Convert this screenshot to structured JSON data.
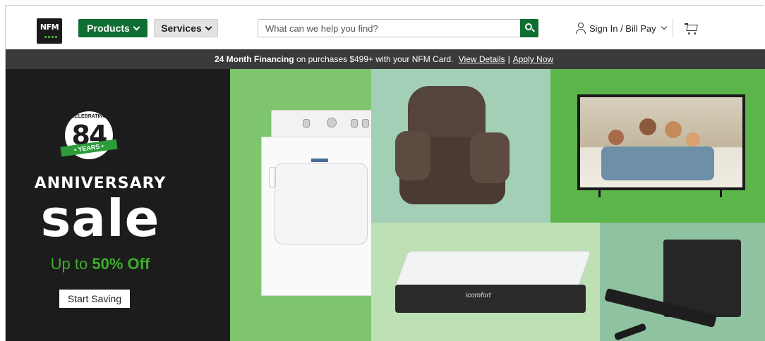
{
  "header": {
    "logo_text": "NFM",
    "products_label": "Products",
    "services_label": "Services",
    "search_placeholder": "What can we help you find?",
    "signin_label": "Sign In / Bill Pay"
  },
  "promo": {
    "bold": "24 Month Financing",
    "text": "on purchases $499+ with your NFM Card.",
    "view_details": "View Details",
    "separator": "|",
    "apply_now": "Apply Now"
  },
  "hero": {
    "badge_celebrating": "CELEBRATING",
    "badge_number": "84",
    "badge_years": "• YEARS •",
    "title": "ANNIVERSARY",
    "sale": "sale",
    "sub_prefix": "Up to",
    "sub_highlight": "50% Off",
    "cta": "Start Saving"
  },
  "products": {
    "mattress_brand": "icomfort"
  },
  "colors": {
    "brand_green": "#0f6e32",
    "accent_green": "#3dae2b",
    "promo_bar": "#3a3a3a",
    "hero_dark": "#1c1c1c"
  }
}
